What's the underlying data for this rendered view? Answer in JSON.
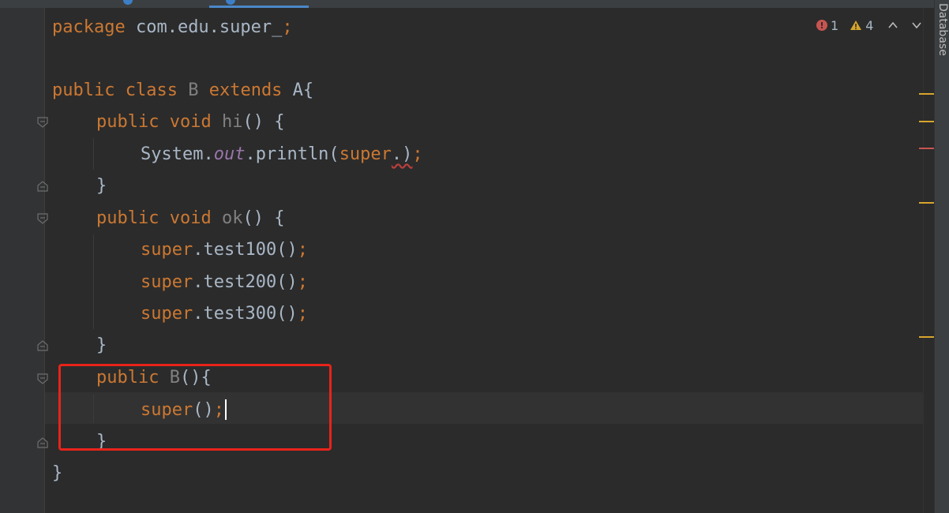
{
  "colors": {
    "background": "#2b2b2b",
    "gutter": "#313335",
    "keyword": "#cc7832",
    "text": "#a9b7c6",
    "unused": "#808080",
    "field": "#9876aa",
    "error": "#c75450",
    "warning": "#d6a52c",
    "highlight_box": "#e8231a"
  },
  "code": {
    "package_kw": "package",
    "package_name": " com.edu.super_",
    "package_semi": ";",
    "line3_public": "public",
    "line3_class": " class",
    "line3_name": " B",
    "line3_extends": " extends",
    "line3_parent": " A{",
    "hi_public": "public",
    "hi_void": " void",
    "hi_name": " hi",
    "hi_rest": "() {",
    "println_pre": "System.",
    "println_out": "out",
    "println_mid": ".println(",
    "println_super": "super",
    "println_dot_paren": ".)",
    "println_semi": ";",
    "close_brace": "}",
    "ok_public": "public",
    "ok_void": " void",
    "ok_name": " ok",
    "ok_rest": "() {",
    "call1_super": "super",
    "call1_rest": ".test100()",
    "call1_semi": ";",
    "call2_super": "super",
    "call2_rest": ".test200()",
    "call2_semi": ";",
    "call3_super": "super",
    "call3_rest": ".test300()",
    "call3_semi": ";",
    "ctor_public": "public",
    "ctor_name": " B",
    "ctor_rest": "(){",
    "ctor_super": "super",
    "ctor_parens": "()",
    "ctor_semi": ";",
    "class_close": "}"
  },
  "inspections": {
    "errors": "1",
    "warnings": "4"
  },
  "sidebar": {
    "database_label": "Database"
  }
}
